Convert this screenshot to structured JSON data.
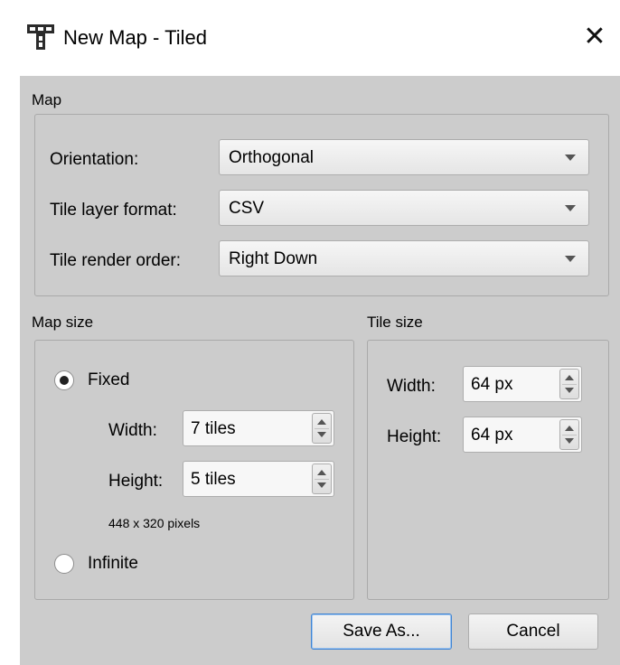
{
  "window": {
    "title": "New Map - Tiled",
    "app_icon": "tiled-logo-icon",
    "close_icon": "close-icon",
    "close_glyph": "✕"
  },
  "map_group": {
    "title": "Map",
    "orientation": {
      "label": "Orientation:",
      "value": "Orthogonal"
    },
    "tile_layer_format": {
      "label": "Tile layer format:",
      "value": "CSV"
    },
    "tile_render_order": {
      "label": "Tile render order:",
      "value": "Right Down"
    }
  },
  "map_size_group": {
    "title": "Map size",
    "fixed": {
      "label": "Fixed",
      "selected": true
    },
    "width": {
      "label": "Width:",
      "value": "7 tiles"
    },
    "height": {
      "label": "Height:",
      "value": "5 tiles"
    },
    "pixel_note": "448 x 320 pixels",
    "infinite": {
      "label": "Infinite",
      "selected": false
    }
  },
  "tile_size_group": {
    "title": "Tile size",
    "width": {
      "label": "Width:",
      "value": "64 px"
    },
    "height": {
      "label": "Height:",
      "value": "64 px"
    }
  },
  "buttons": {
    "save_as": "Save As...",
    "cancel": "Cancel"
  },
  "colors": {
    "dialog_bg": "#cccccc",
    "titlebar_bg": "#ffffff",
    "default_button_border": "#3f84d4"
  }
}
